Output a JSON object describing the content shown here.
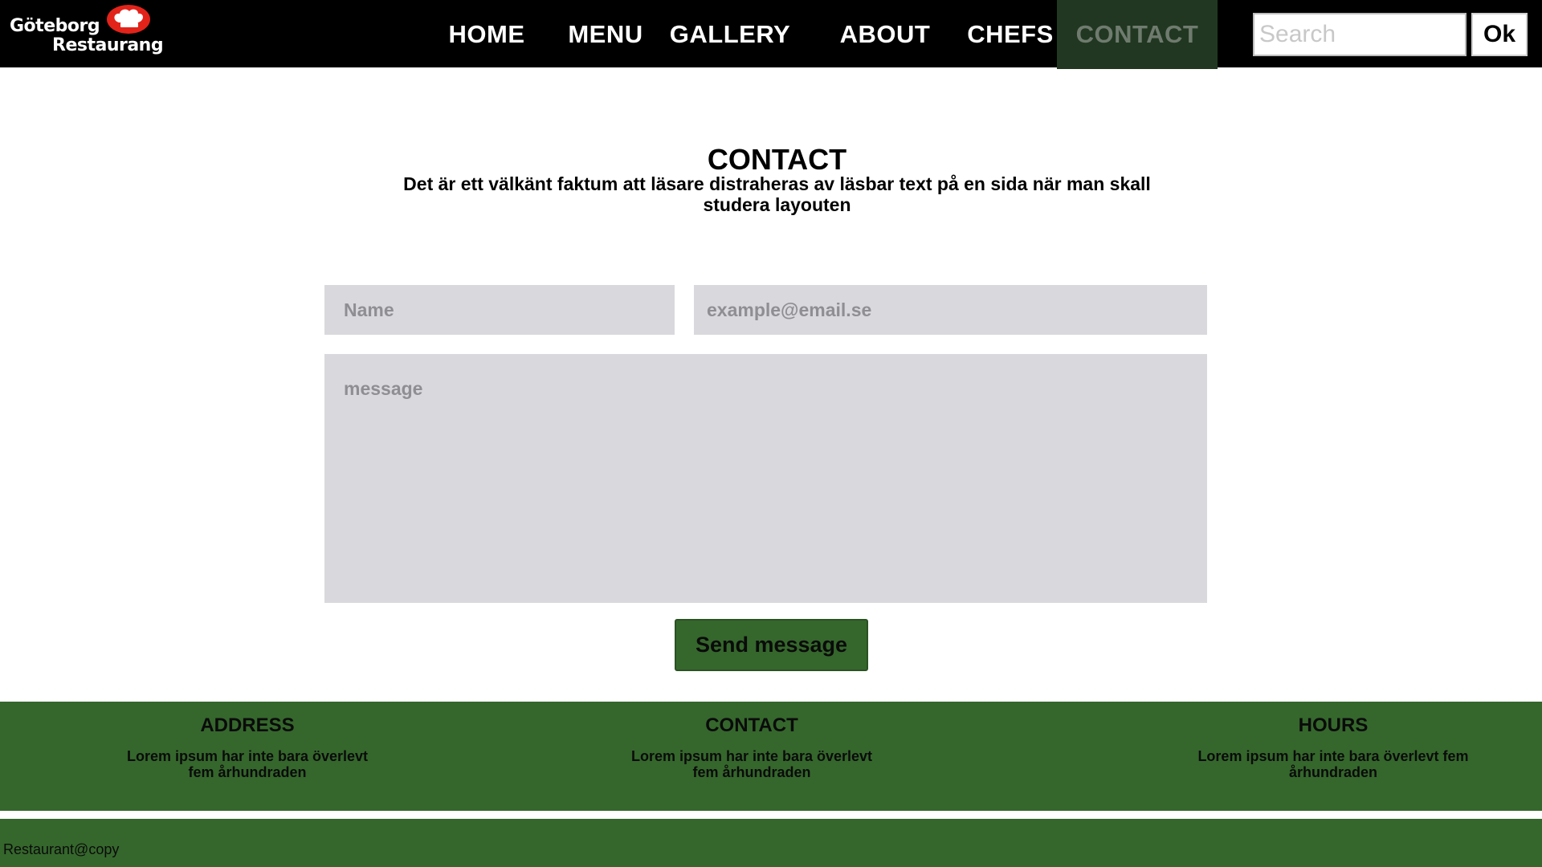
{
  "header": {
    "logo": {
      "line1": "Göteborg",
      "line2": "Restaurang"
    },
    "nav": [
      {
        "label": "HOME"
      },
      {
        "label": "MENU"
      },
      {
        "label": "GALLERY"
      },
      {
        "label": "ABOUT"
      },
      {
        "label": "CHEFS"
      },
      {
        "label": "CONTACT",
        "active": true
      }
    ],
    "search": {
      "placeholder": "Search",
      "button_label": "Ok"
    }
  },
  "main": {
    "title": "CONTACT",
    "subtitle": "Det är ett välkänt faktum att läsare distraheras av läsbar text på en sida när man skall studera layouten",
    "form": {
      "name_placeholder": "Name",
      "email_placeholder": "example@email.se",
      "message_placeholder": "message",
      "submit_label": "Send message"
    }
  },
  "footer": {
    "columns": [
      {
        "heading": "ADDRESS",
        "text": "Lorem ipsum har inte bara överlevt fem århundraden"
      },
      {
        "heading": "CONTACT",
        "text": "Lorem ipsum har inte bara överlevt fem århundraden"
      },
      {
        "heading": "HOURS",
        "text": "Lorem ipsum har inte bara överlevt fem århundraden"
      }
    ],
    "copyright": "Restaurant@copy"
  },
  "colors": {
    "header_bg": "#000000",
    "nav_active_bg": "#213721",
    "nav_active_text": "#6e7b6e",
    "accent_green": "#35672c",
    "field_bg": "#d9d9dd",
    "logo_hat_red": "#e2231a"
  }
}
